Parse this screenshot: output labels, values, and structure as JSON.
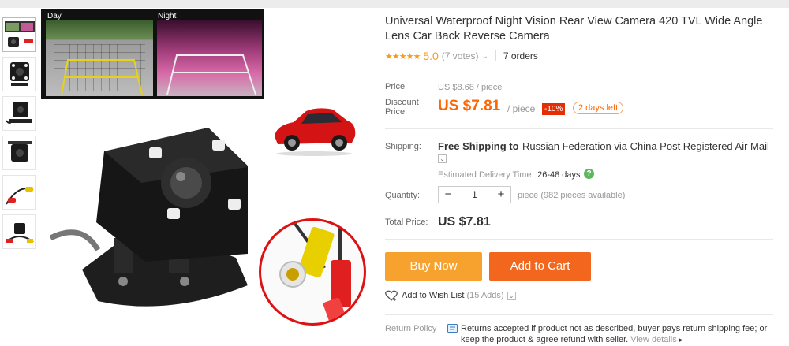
{
  "product": {
    "title": "Universal Waterproof Night Vision Rear View Camera 420 TVL Wide Angle Lens Car Back Reverse Camera",
    "rating_stars": "★★★★★",
    "rating_value": "5.0",
    "votes": "(7 votes)",
    "orders": "7 orders"
  },
  "gallery": {
    "day_label": "Day",
    "night_label": "Night"
  },
  "price": {
    "label": "Price:",
    "original": "US $8.68 / piece",
    "discount_label": "Discount Price:",
    "discount_price": "US $7.81",
    "unit": "/ piece",
    "percent_off": "-10%",
    "days_left": "2 days left"
  },
  "shipping": {
    "label": "Shipping:",
    "free_label": "Free Shipping to",
    "destination": "Russian Federation via China Post Registered Air Mail",
    "estimated_label": "Estimated Delivery Time:",
    "estimated_value": "26-48 days",
    "help_icon": "?"
  },
  "quantity": {
    "label": "Quantity:",
    "minus": "−",
    "value": "1",
    "plus": "+",
    "note": "piece (982 pieces available)"
  },
  "total": {
    "label": "Total Price:",
    "value": "US $7.81"
  },
  "actions": {
    "buy_now": "Buy Now",
    "add_to_cart": "Add to Cart",
    "wishlist": "Add to Wish List",
    "wishlist_count": "(15 Adds)"
  },
  "returns": {
    "label": "Return Policy",
    "text": "Returns accepted if product not as described, buyer pays return shipping fee; or keep the product & agree refund with seller.",
    "link": "View details"
  },
  "colors": {
    "accent_orange": "#ff6600",
    "buy_now": "#f7a22f",
    "add_to_cart": "#f3661d",
    "discount_badge": "#e62e04",
    "star": "#f79b1f"
  }
}
